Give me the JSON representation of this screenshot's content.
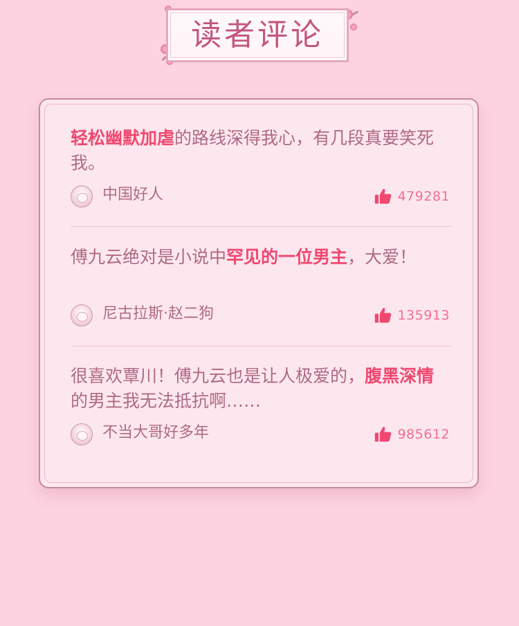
{
  "header": {
    "title": "读者评论"
  },
  "colors": {
    "background": "#fdd3e1",
    "card": "#fde7ef",
    "text": "#ae6a84",
    "highlight": "#f04870",
    "like": "#f0708e"
  },
  "comments": [
    {
      "segments": [
        {
          "text": "轻松幽默加虐",
          "highlight": true
        },
        {
          "text": "的路线深得我心，有几段真要笑死我。",
          "highlight": false
        }
      ],
      "user": "中国好人",
      "likes": "479281",
      "avatar_icon": "anime-girl-avatar"
    },
    {
      "segments": [
        {
          "text": "傅九云绝对是小说中",
          "highlight": false
        },
        {
          "text": "罕见的一位男主",
          "highlight": true
        },
        {
          "text": "，大爱！",
          "highlight": false
        }
      ],
      "user": "尼古拉斯·赵二狗",
      "likes": "135913",
      "avatar_icon": "anime-cat-avatar"
    },
    {
      "segments": [
        {
          "text": "很喜欢覃川！傅九云也是让人极爱的，",
          "highlight": false
        },
        {
          "text": "腹黑深情",
          "highlight": true
        },
        {
          "text": "的男主我无法抵抗啊……",
          "highlight": false
        }
      ],
      "user": "不当大哥好多年",
      "likes": "985612",
      "avatar_icon": "rabbit-avatar"
    }
  ]
}
